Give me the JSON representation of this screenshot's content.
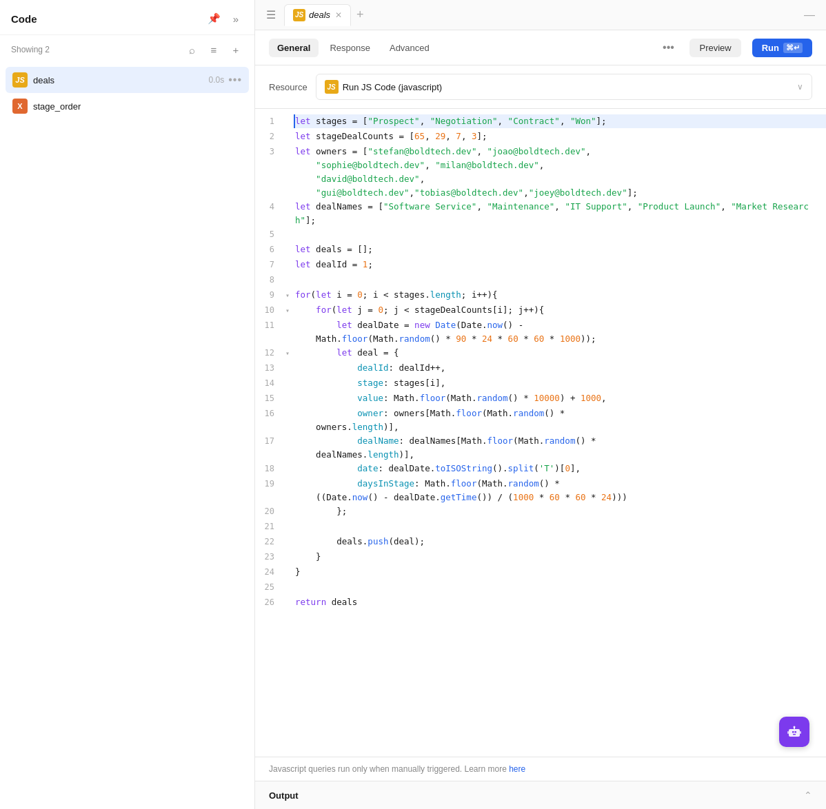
{
  "sidebar": {
    "title": "Code",
    "showing": "Showing 2",
    "items": [
      {
        "id": "deals",
        "name": "deals",
        "badge": "JS",
        "badgeType": "js",
        "time": "0.0s",
        "active": true
      },
      {
        "id": "stage_order",
        "name": "stage_order",
        "badge": "X",
        "badgeType": "x",
        "time": "",
        "active": false
      }
    ]
  },
  "tabs": [
    {
      "id": "deals",
      "name": "deals",
      "badge": "JS",
      "active": true
    }
  ],
  "toolbar": {
    "tabs": [
      {
        "id": "general",
        "label": "General",
        "active": true
      },
      {
        "id": "response",
        "label": "Response",
        "active": false
      },
      {
        "id": "advanced",
        "label": "Advanced",
        "active": false
      }
    ],
    "preview_label": "Preview",
    "run_label": "Run",
    "run_shortcut": "⌘↵"
  },
  "resource": {
    "label": "Resource",
    "value": "Run JS Code (javascript)",
    "badge": "JS"
  },
  "code": {
    "lines": [
      {
        "num": 1,
        "content": "let stages = [\"Prospect\", \"Negotiation\", \"Contract\", \"Won\"];",
        "collapsible": false
      },
      {
        "num": 2,
        "content": "let stageDealCounts = [65, 29, 7, 3];",
        "collapsible": false
      },
      {
        "num": 3,
        "content": "let owners = [\"stefan@boldtech.dev\", \"joao@boldtech.dev\",\n    \"sophie@boldtech.dev\", \"milan@boldtech.dev\",\n    \"david@boldtech.dev\",\n    \"gui@boldtech.dev\",\"tobias@boldtech.dev\",\"joey@boldtech.dev\"];",
        "collapsible": false
      },
      {
        "num": 4,
        "content": "let dealNames = [\"Software Service\", \"Maintenance\", \"IT Support\", \"Product Launch\", \"Market Research\"];",
        "collapsible": false
      },
      {
        "num": 5,
        "content": "",
        "collapsible": false
      },
      {
        "num": 6,
        "content": "let deals = [];",
        "collapsible": false
      },
      {
        "num": 7,
        "content": "let dealId = 1;",
        "collapsible": false
      },
      {
        "num": 8,
        "content": "",
        "collapsible": false
      },
      {
        "num": 9,
        "content": "for(let i = 0; i < stages.length; i++){",
        "collapsible": true
      },
      {
        "num": 10,
        "content": "    for(let j = 0; j < stageDealCounts[i]; j++){",
        "collapsible": true
      },
      {
        "num": 11,
        "content": "        let dealDate = new Date(Date.now() -\n    Math.floor(Math.random() * 90 * 24 * 60 * 60 * 1000));",
        "collapsible": false
      },
      {
        "num": 12,
        "content": "        let deal = {",
        "collapsible": true
      },
      {
        "num": 13,
        "content": "            dealId: dealId++,",
        "collapsible": false
      },
      {
        "num": 14,
        "content": "            stage: stages[i],",
        "collapsible": false
      },
      {
        "num": 15,
        "content": "            value: Math.floor(Math.random() * 10000) + 1000,",
        "collapsible": false
      },
      {
        "num": 16,
        "content": "            owner: owners[Math.floor(Math.random() *\n    owners.length)],",
        "collapsible": false
      },
      {
        "num": 17,
        "content": "            dealName: dealNames[Math.floor(Math.random() *\n    dealNames.length)],",
        "collapsible": false
      },
      {
        "num": 18,
        "content": "            date: dealDate.toISOString().split('T')[0],",
        "collapsible": false
      },
      {
        "num": 19,
        "content": "            daysInStage: Math.floor(Math.random() *\n    ((Date.now() - dealDate.getTime()) / (1000 * 60 * 60 * 24)))",
        "collapsible": false
      },
      {
        "num": 20,
        "content": "        };",
        "collapsible": false
      },
      {
        "num": 21,
        "content": "",
        "collapsible": false
      },
      {
        "num": 22,
        "content": "        deals.push(deal);",
        "collapsible": false
      },
      {
        "num": 23,
        "content": "    }",
        "collapsible": false
      },
      {
        "num": 24,
        "content": "}",
        "collapsible": false
      },
      {
        "num": 25,
        "content": "",
        "collapsible": false
      },
      {
        "num": 26,
        "content": "return deals",
        "collapsible": false
      }
    ]
  },
  "bottom": {
    "notice": "Javascript queries run only when manually triggered. Learn more ",
    "notice_link": "here",
    "output_label": "Output"
  }
}
